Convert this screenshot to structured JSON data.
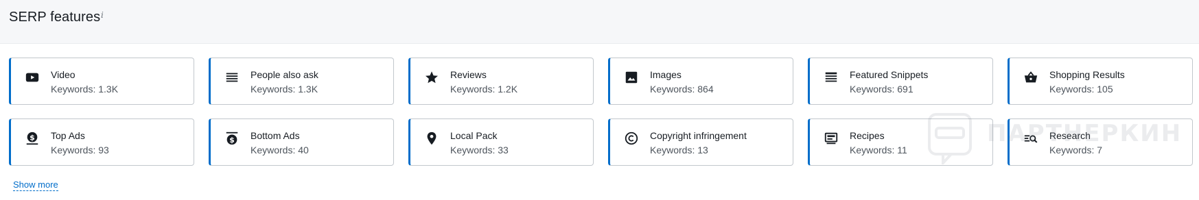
{
  "header": {
    "title": "SERP features",
    "info_label": "i"
  },
  "cards": [
    {
      "name": "Video",
      "count": "Keywords: 1.3K",
      "icon": "youtube-icon"
    },
    {
      "name": "People also ask",
      "count": "Keywords: 1.3K",
      "icon": "list-icon"
    },
    {
      "name": "Reviews",
      "count": "Keywords: 1.2K",
      "icon": "star-icon"
    },
    {
      "name": "Images",
      "count": "Keywords: 864",
      "icon": "image-icon"
    },
    {
      "name": "Featured Snippets",
      "count": "Keywords: 691",
      "icon": "snippet-icon"
    },
    {
      "name": "Shopping Results",
      "count": "Keywords: 105",
      "icon": "basket-icon"
    },
    {
      "name": "Top Ads",
      "count": "Keywords: 93",
      "icon": "dollar-top-icon"
    },
    {
      "name": "Bottom Ads",
      "count": "Keywords: 40",
      "icon": "dollar-bottom-icon"
    },
    {
      "name": "Local Pack",
      "count": "Keywords: 33",
      "icon": "map-pin-icon"
    },
    {
      "name": "Copyright infringement",
      "count": "Keywords: 13",
      "icon": "copyright-icon"
    },
    {
      "name": "Recipes",
      "count": "Keywords: 11",
      "icon": "recipe-icon"
    },
    {
      "name": "Research",
      "count": "Keywords: 7",
      "icon": "research-icon"
    }
  ],
  "footer": {
    "show_more": "Show more"
  },
  "watermark": {
    "text": "ПАРТНЕРКИН"
  },
  "colors": {
    "accent": "#006dca",
    "border": "#c2c7cc",
    "header_bg": "#f6f7f9",
    "text": "#171c22",
    "muted": "#4d545c"
  }
}
